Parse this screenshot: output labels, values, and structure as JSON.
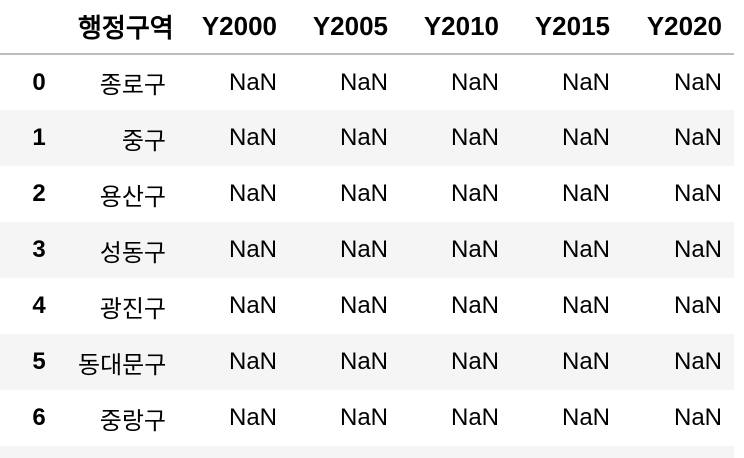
{
  "table": {
    "index_header": "",
    "columns": [
      "행정구역",
      "Y2000",
      "Y2005",
      "Y2010",
      "Y2015",
      "Y2020"
    ],
    "rows": [
      {
        "index": "0",
        "cells": [
          "종로구",
          "NaN",
          "NaN",
          "NaN",
          "NaN",
          "NaN"
        ]
      },
      {
        "index": "1",
        "cells": [
          "중구",
          "NaN",
          "NaN",
          "NaN",
          "NaN",
          "NaN"
        ]
      },
      {
        "index": "2",
        "cells": [
          "용산구",
          "NaN",
          "NaN",
          "NaN",
          "NaN",
          "NaN"
        ]
      },
      {
        "index": "3",
        "cells": [
          "성동구",
          "NaN",
          "NaN",
          "NaN",
          "NaN",
          "NaN"
        ]
      },
      {
        "index": "4",
        "cells": [
          "광진구",
          "NaN",
          "NaN",
          "NaN",
          "NaN",
          "NaN"
        ]
      },
      {
        "index": "5",
        "cells": [
          "동대문구",
          "NaN",
          "NaN",
          "NaN",
          "NaN",
          "NaN"
        ]
      },
      {
        "index": "6",
        "cells": [
          "중랑구",
          "NaN",
          "NaN",
          "NaN",
          "NaN",
          "NaN"
        ]
      }
    ]
  },
  "colors": {
    "header_rule": "#bdbdbd",
    "striped_row": "#f5f5f5",
    "text": "#000000"
  }
}
